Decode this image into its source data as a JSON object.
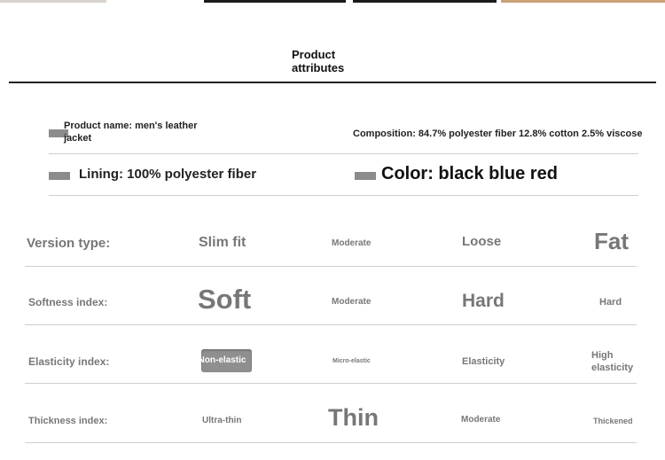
{
  "section_title": "Product\nattributes",
  "info": {
    "product_name": "Product name: men's leather\njacket",
    "composition": "Composition: 84.7% polyester fiber 12.8% cotton 2.5% viscose",
    "lining": "Lining: 100% polyester fiber",
    "color": "Color: black blue red"
  },
  "attributes": [
    {
      "label": "Version type:",
      "options": [
        "Slim fit",
        "Moderate",
        "Loose",
        "Fat"
      ]
    },
    {
      "label": "Softness index:",
      "options": [
        "Soft",
        "Moderate",
        "Hard",
        "Hard"
      ]
    },
    {
      "label": "Elasticity index:",
      "options": [
        "Non-elastic",
        "Micro-elastic",
        "Elasticity",
        "High\nelasticity"
      ]
    },
    {
      "label": "Thickness index:",
      "options": [
        "Ultra-thin",
        "Thin",
        "Moderate",
        "Thickened"
      ]
    }
  ],
  "colors": {
    "text_dark": "#111111",
    "text_grey": "#777777",
    "bullet": "#8c8c8c",
    "rule": "#cfcfcf"
  }
}
